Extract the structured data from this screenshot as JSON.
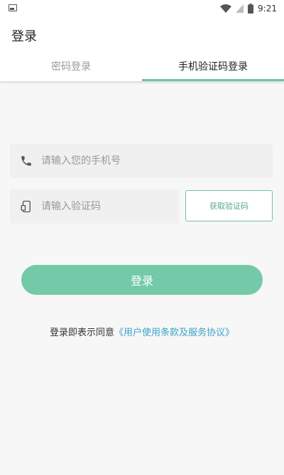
{
  "status_bar": {
    "time": "9:21"
  },
  "header": {
    "title": "登录"
  },
  "tabs": [
    {
      "label": "密码登录",
      "active": false
    },
    {
      "label": "手机验证码登录",
      "active": true
    }
  ],
  "form": {
    "phone_placeholder": "请输入您的手机号",
    "code_placeholder": "请输入验证码",
    "get_code_label": "获取验证码",
    "login_label": "登录"
  },
  "agreement": {
    "prefix": "登录即表示同意",
    "link": "《用户使用条款及服务协议》"
  },
  "colors": {
    "accent": "#74c9a9",
    "link": "#3aa3c9"
  },
  "icons": {
    "phone": "phone-icon",
    "device": "device-icon"
  }
}
